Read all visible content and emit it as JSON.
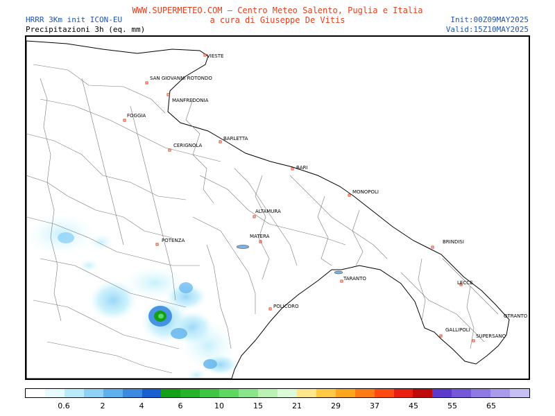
{
  "header": {
    "model": "HRRR 3Km init ICON-EU",
    "parameter": "Precipitazioni 3h (eq. mm)",
    "site": "WWW.SUPERMETEO.COM — Centro Meteo Salento, Puglia e Italia",
    "author": "a cura di Giuseppe De Vitis",
    "init": "Init:00Z09MAY2025",
    "valid": "Valid:15Z10MAY2025"
  },
  "cities": [
    "VIESTE",
    "SAN GIOVANNI ROTONDO",
    "MANFREDONIA",
    "FOGGIA",
    "CERIGNOLA",
    "BARLETTA",
    "BARI",
    "MONOPOLI",
    "ALTAMURA",
    "MATERA",
    "POTENZA",
    "BRINDISI",
    "TARANTO",
    "LECCE",
    "POLICORO",
    "OTRANTO",
    "GALLIPOLI",
    "SUPERSANO"
  ],
  "legend": {
    "colors": [
      "#ffffff",
      "#e6fbff",
      "#b9ecfb",
      "#8fd2f6",
      "#5fb1ee",
      "#3b8ae0",
      "#1a5fd0",
      "#13a019",
      "#26b32c",
      "#3cc642",
      "#5dd862",
      "#8ae68a",
      "#b9f2b2",
      "#dcfad7",
      "#ffe68c",
      "#ffc845",
      "#ffa61e",
      "#ff7a14",
      "#ff4a12",
      "#e81e12",
      "#c00a0a",
      "#5b3acb",
      "#7558d8",
      "#8e7ae2",
      "#a99bea",
      "#c6bff2"
    ],
    "labels": [
      "0.6",
      "2",
      "4",
      "6",
      "10",
      "15",
      "21",
      "29",
      "37",
      "45",
      "55",
      "65"
    ]
  }
}
